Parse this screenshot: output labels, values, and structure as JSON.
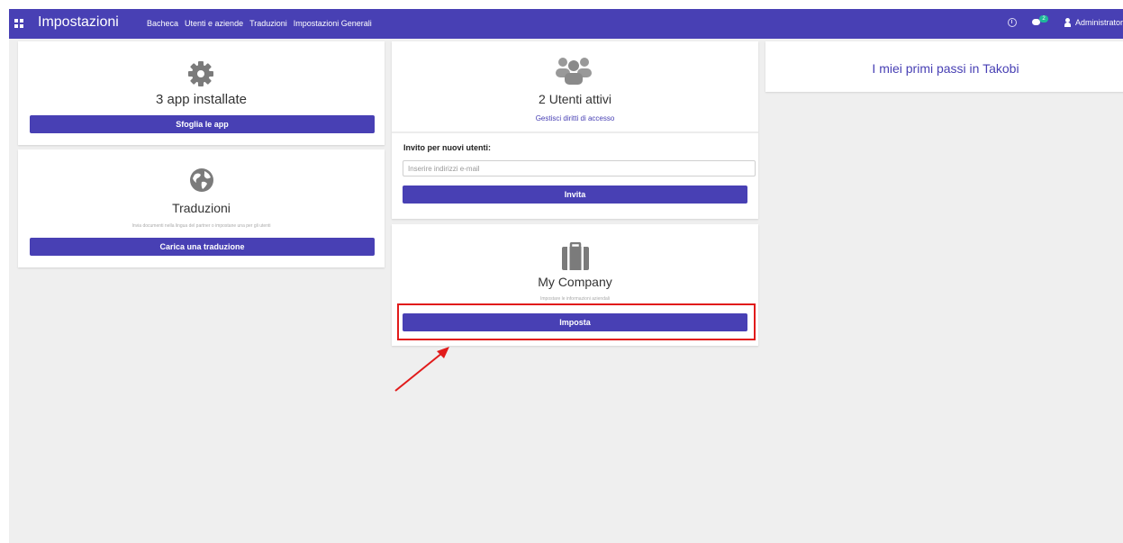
{
  "navbar": {
    "title": "Impostazioni",
    "menu": [
      "Bacheca",
      "Utenti e aziende",
      "Traduzioni",
      "Impostazioni Generali"
    ],
    "chat_count": "2",
    "user": "Administrator"
  },
  "apps_card": {
    "icon": "gear-icon",
    "title": "3 app installate",
    "button": "Sfoglia le app"
  },
  "translations_card": {
    "icon": "globe-icon",
    "title": "Traduzioni",
    "subtitle": "Invia documenti nella lingua del partner o impostane una per gli utenti",
    "button": "Carica una traduzione"
  },
  "users_card": {
    "icon": "users-icon",
    "title": "2 Utenti attivi",
    "link": "Gestisci diritti di accesso",
    "invite_label": "Invito per nuovi utenti:",
    "email_placeholder": "Inserire indirizzi e-mail",
    "invite_button": "Invita"
  },
  "company_card": {
    "icon": "briefcase-icon",
    "title": "My Company",
    "subtitle": "Impostare le informazioni aziendali",
    "button": "Imposta"
  },
  "onboarding_card": {
    "title": "I miei primi passi in Takobi"
  },
  "colors": {
    "primary": "#4840b4",
    "background": "#efefef",
    "highlight": "#e11b1b",
    "badge": "#1fb89a"
  }
}
